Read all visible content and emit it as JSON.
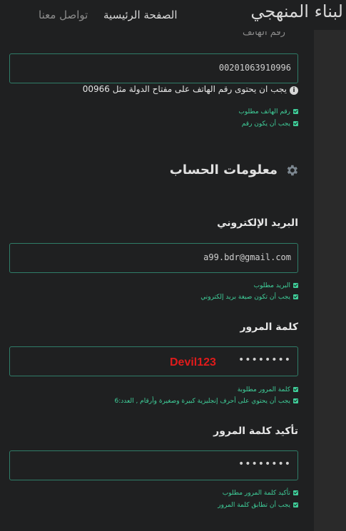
{
  "header": {
    "brand": "لبناء المنهجي",
    "nav_home": "الصفحة الرئيسية",
    "nav_contact": "تواصل معنا"
  },
  "phone": {
    "label_cut": "رقم الهاتف",
    "value": "00201063910996",
    "hint": "يجب ان يحتوى رقم الهاتف على مفتاح الدولة مثل 00966",
    "checks": [
      "رقم الهاتف مطلوب",
      "يجب أن يكون رقم"
    ]
  },
  "account": {
    "title": "معلومات الحساب",
    "email": {
      "label": "البريد الإلكتروني",
      "value": "a99.bdr@gmail.com",
      "checks": [
        "البريد مطلوب",
        "يجب أن تكون صيغة بريد إلكتروني"
      ]
    },
    "password": {
      "label": "كلمة المرور",
      "dots": "••••••••",
      "overlay": "Devil123",
      "checks": [
        "كلمة المرور مطلوبة",
        "يجب أن يحتوي على أحرف إنجليزية كبيرة وصغيرة وأرقام , العدد:6"
      ]
    },
    "confirm": {
      "label": "تأكيد كلمة المرور",
      "dots": "••••••••",
      "checks": [
        "تأكيد كلمة المرور مطلوب",
        "يجب أن تطابق كلمة المرور"
      ]
    }
  },
  "colors": {
    "accent": "#3fcf9a",
    "border": "#2f7d68",
    "overlay": "#e01b1b"
  }
}
